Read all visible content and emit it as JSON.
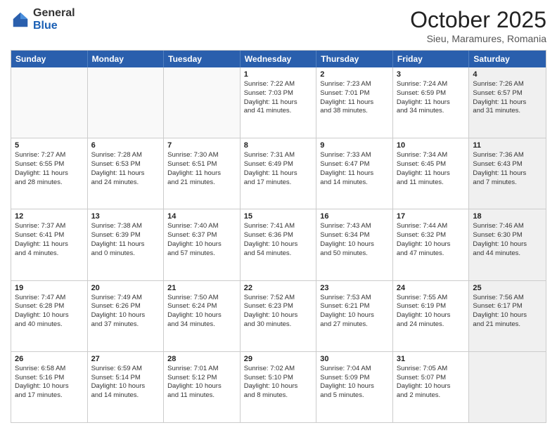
{
  "logo": {
    "general": "General",
    "blue": "Blue"
  },
  "header": {
    "month": "October 2025",
    "location": "Sieu, Maramures, Romania"
  },
  "weekdays": [
    "Sunday",
    "Monday",
    "Tuesday",
    "Wednesday",
    "Thursday",
    "Friday",
    "Saturday"
  ],
  "rows": [
    [
      {
        "day": "",
        "lines": [],
        "empty": true
      },
      {
        "day": "",
        "lines": [],
        "empty": true
      },
      {
        "day": "",
        "lines": [],
        "empty": true
      },
      {
        "day": "1",
        "lines": [
          "Sunrise: 7:22 AM",
          "Sunset: 7:03 PM",
          "Daylight: 11 hours",
          "and 41 minutes."
        ]
      },
      {
        "day": "2",
        "lines": [
          "Sunrise: 7:23 AM",
          "Sunset: 7:01 PM",
          "Daylight: 11 hours",
          "and 38 minutes."
        ]
      },
      {
        "day": "3",
        "lines": [
          "Sunrise: 7:24 AM",
          "Sunset: 6:59 PM",
          "Daylight: 11 hours",
          "and 34 minutes."
        ]
      },
      {
        "day": "4",
        "lines": [
          "Sunrise: 7:26 AM",
          "Sunset: 6:57 PM",
          "Daylight: 11 hours",
          "and 31 minutes."
        ],
        "shaded": true
      }
    ],
    [
      {
        "day": "5",
        "lines": [
          "Sunrise: 7:27 AM",
          "Sunset: 6:55 PM",
          "Daylight: 11 hours",
          "and 28 minutes."
        ]
      },
      {
        "day": "6",
        "lines": [
          "Sunrise: 7:28 AM",
          "Sunset: 6:53 PM",
          "Daylight: 11 hours",
          "and 24 minutes."
        ]
      },
      {
        "day": "7",
        "lines": [
          "Sunrise: 7:30 AM",
          "Sunset: 6:51 PM",
          "Daylight: 11 hours",
          "and 21 minutes."
        ]
      },
      {
        "day": "8",
        "lines": [
          "Sunrise: 7:31 AM",
          "Sunset: 6:49 PM",
          "Daylight: 11 hours",
          "and 17 minutes."
        ]
      },
      {
        "day": "9",
        "lines": [
          "Sunrise: 7:33 AM",
          "Sunset: 6:47 PM",
          "Daylight: 11 hours",
          "and 14 minutes."
        ]
      },
      {
        "day": "10",
        "lines": [
          "Sunrise: 7:34 AM",
          "Sunset: 6:45 PM",
          "Daylight: 11 hours",
          "and 11 minutes."
        ]
      },
      {
        "day": "11",
        "lines": [
          "Sunrise: 7:36 AM",
          "Sunset: 6:43 PM",
          "Daylight: 11 hours",
          "and 7 minutes."
        ],
        "shaded": true
      }
    ],
    [
      {
        "day": "12",
        "lines": [
          "Sunrise: 7:37 AM",
          "Sunset: 6:41 PM",
          "Daylight: 11 hours",
          "and 4 minutes."
        ]
      },
      {
        "day": "13",
        "lines": [
          "Sunrise: 7:38 AM",
          "Sunset: 6:39 PM",
          "Daylight: 11 hours",
          "and 0 minutes."
        ]
      },
      {
        "day": "14",
        "lines": [
          "Sunrise: 7:40 AM",
          "Sunset: 6:37 PM",
          "Daylight: 10 hours",
          "and 57 minutes."
        ]
      },
      {
        "day": "15",
        "lines": [
          "Sunrise: 7:41 AM",
          "Sunset: 6:36 PM",
          "Daylight: 10 hours",
          "and 54 minutes."
        ]
      },
      {
        "day": "16",
        "lines": [
          "Sunrise: 7:43 AM",
          "Sunset: 6:34 PM",
          "Daylight: 10 hours",
          "and 50 minutes."
        ]
      },
      {
        "day": "17",
        "lines": [
          "Sunrise: 7:44 AM",
          "Sunset: 6:32 PM",
          "Daylight: 10 hours",
          "and 47 minutes."
        ]
      },
      {
        "day": "18",
        "lines": [
          "Sunrise: 7:46 AM",
          "Sunset: 6:30 PM",
          "Daylight: 10 hours",
          "and 44 minutes."
        ],
        "shaded": true
      }
    ],
    [
      {
        "day": "19",
        "lines": [
          "Sunrise: 7:47 AM",
          "Sunset: 6:28 PM",
          "Daylight: 10 hours",
          "and 40 minutes."
        ]
      },
      {
        "day": "20",
        "lines": [
          "Sunrise: 7:49 AM",
          "Sunset: 6:26 PM",
          "Daylight: 10 hours",
          "and 37 minutes."
        ]
      },
      {
        "day": "21",
        "lines": [
          "Sunrise: 7:50 AM",
          "Sunset: 6:24 PM",
          "Daylight: 10 hours",
          "and 34 minutes."
        ]
      },
      {
        "day": "22",
        "lines": [
          "Sunrise: 7:52 AM",
          "Sunset: 6:23 PM",
          "Daylight: 10 hours",
          "and 30 minutes."
        ]
      },
      {
        "day": "23",
        "lines": [
          "Sunrise: 7:53 AM",
          "Sunset: 6:21 PM",
          "Daylight: 10 hours",
          "and 27 minutes."
        ]
      },
      {
        "day": "24",
        "lines": [
          "Sunrise: 7:55 AM",
          "Sunset: 6:19 PM",
          "Daylight: 10 hours",
          "and 24 minutes."
        ]
      },
      {
        "day": "25",
        "lines": [
          "Sunrise: 7:56 AM",
          "Sunset: 6:17 PM",
          "Daylight: 10 hours",
          "and 21 minutes."
        ],
        "shaded": true
      }
    ],
    [
      {
        "day": "26",
        "lines": [
          "Sunrise: 6:58 AM",
          "Sunset: 5:16 PM",
          "Daylight: 10 hours",
          "and 17 minutes."
        ]
      },
      {
        "day": "27",
        "lines": [
          "Sunrise: 6:59 AM",
          "Sunset: 5:14 PM",
          "Daylight: 10 hours",
          "and 14 minutes."
        ]
      },
      {
        "day": "28",
        "lines": [
          "Sunrise: 7:01 AM",
          "Sunset: 5:12 PM",
          "Daylight: 10 hours",
          "and 11 minutes."
        ]
      },
      {
        "day": "29",
        "lines": [
          "Sunrise: 7:02 AM",
          "Sunset: 5:10 PM",
          "Daylight: 10 hours",
          "and 8 minutes."
        ]
      },
      {
        "day": "30",
        "lines": [
          "Sunrise: 7:04 AM",
          "Sunset: 5:09 PM",
          "Daylight: 10 hours",
          "and 5 minutes."
        ]
      },
      {
        "day": "31",
        "lines": [
          "Sunrise: 7:05 AM",
          "Sunset: 5:07 PM",
          "Daylight: 10 hours",
          "and 2 minutes."
        ]
      },
      {
        "day": "",
        "lines": [],
        "empty": true,
        "shaded": true
      }
    ]
  ]
}
